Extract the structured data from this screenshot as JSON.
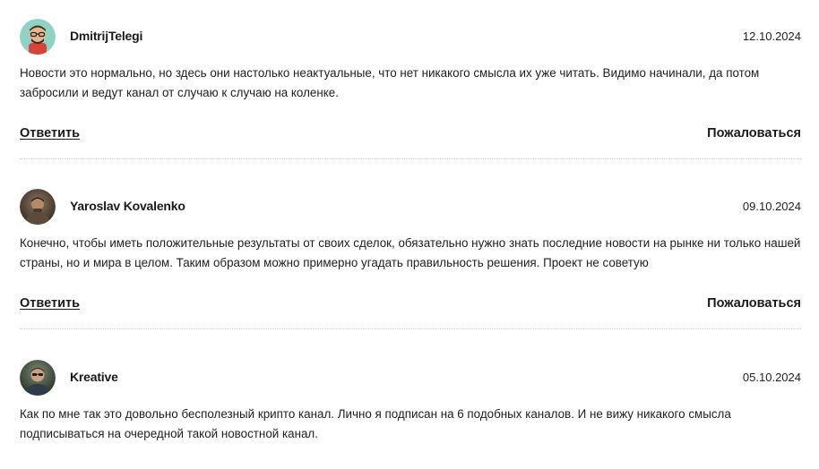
{
  "comments": [
    {
      "author": "DmitrijTelegi",
      "date": "12.10.2024",
      "text": "Новости это нормально, но здесь они настолько неактуальные, что нет никакого смысла их уже читать. Видимо начинали, да потом забросили и ведут канал от случаю к случаю на коленке.",
      "reply_label": "Ответить",
      "report_label": "Пожаловаться",
      "avatar_icon": "cartoon-avatar-icon",
      "avatar_bg": "#8fd3c5"
    },
    {
      "author": "Yaroslav Kovalenko",
      "date": "09.10.2024",
      "text": "Конечно, чтобы иметь положительные результаты от своих сделок, обязательно нужно знать последние новости на рынке ни только нашей страны, но и мира в целом. Таким образом можно примерно угадать правильность решения. Проект не советую",
      "reply_label": "Ответить",
      "report_label": "Пожаловаться",
      "avatar_icon": "photo-avatar-icon",
      "avatar_bg": "#5a4636"
    },
    {
      "author": "Kreative",
      "date": "05.10.2024",
      "text": "Как по мне так это довольно бесполезный крипто канал. Лично я подписан на 6 подобных каналов. И не вижу никакого смысла подписываться на очередной такой новостной канал.",
      "reply_label": "",
      "report_label": "",
      "avatar_icon": "photo-avatar-icon",
      "avatar_bg": "#3c4a3a"
    }
  ],
  "colors": {
    "text": "#1e1e1e",
    "divider": "#cfcfcf"
  }
}
